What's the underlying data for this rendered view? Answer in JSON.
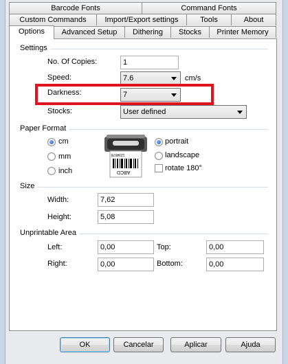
{
  "tabs": {
    "row1": [
      "Barcode Fonts",
      "Command Fonts"
    ],
    "row2": [
      "Custom Commands",
      "Import/Export settings",
      "Tools",
      "About"
    ],
    "row3": [
      "Options",
      "Advanced Setup",
      "Dithering",
      "Stocks",
      "Printer Memory"
    ],
    "active": "Options"
  },
  "settings": {
    "title": "Settings",
    "copies_label": "No. Of Copies:",
    "copies_value": "1",
    "speed_label": "Speed:",
    "speed_value": "7.6",
    "speed_unit": "cm/s",
    "darkness_label": "Darkness:",
    "darkness_value": "7",
    "stocks_label": "Stocks:",
    "stocks_value": "User defined"
  },
  "paper_format": {
    "title": "Paper Format",
    "units": [
      "cm",
      "mm",
      "inch"
    ],
    "selected_unit": "cm",
    "label_text": "ABCD",
    "label_code": "1234578",
    "orientations": [
      "portrait",
      "landscape"
    ],
    "selected_orientation": "portrait",
    "rotate_label": "rotate 180°",
    "rotate_checked": false
  },
  "size": {
    "title": "Size",
    "width_label": "Width:",
    "width_value": "7,62",
    "height_label": "Height:",
    "height_value": "5,08"
  },
  "unprintable": {
    "title": "Unprintable Area",
    "left_label": "Left:",
    "left_value": "0,00",
    "top_label": "Top:",
    "top_value": "0,00",
    "right_label": "Right:",
    "right_value": "0,00",
    "bottom_label": "Bottom:",
    "bottom_value": "0,00"
  },
  "buttons": {
    "ok": "OK",
    "cancel": "Cancelar",
    "apply": "Aplicar",
    "help": "Ajuda"
  },
  "colors": {
    "highlight": "#e0141e",
    "radio_selected": "#1a56c9",
    "panel_border": "#8e8f8f"
  }
}
